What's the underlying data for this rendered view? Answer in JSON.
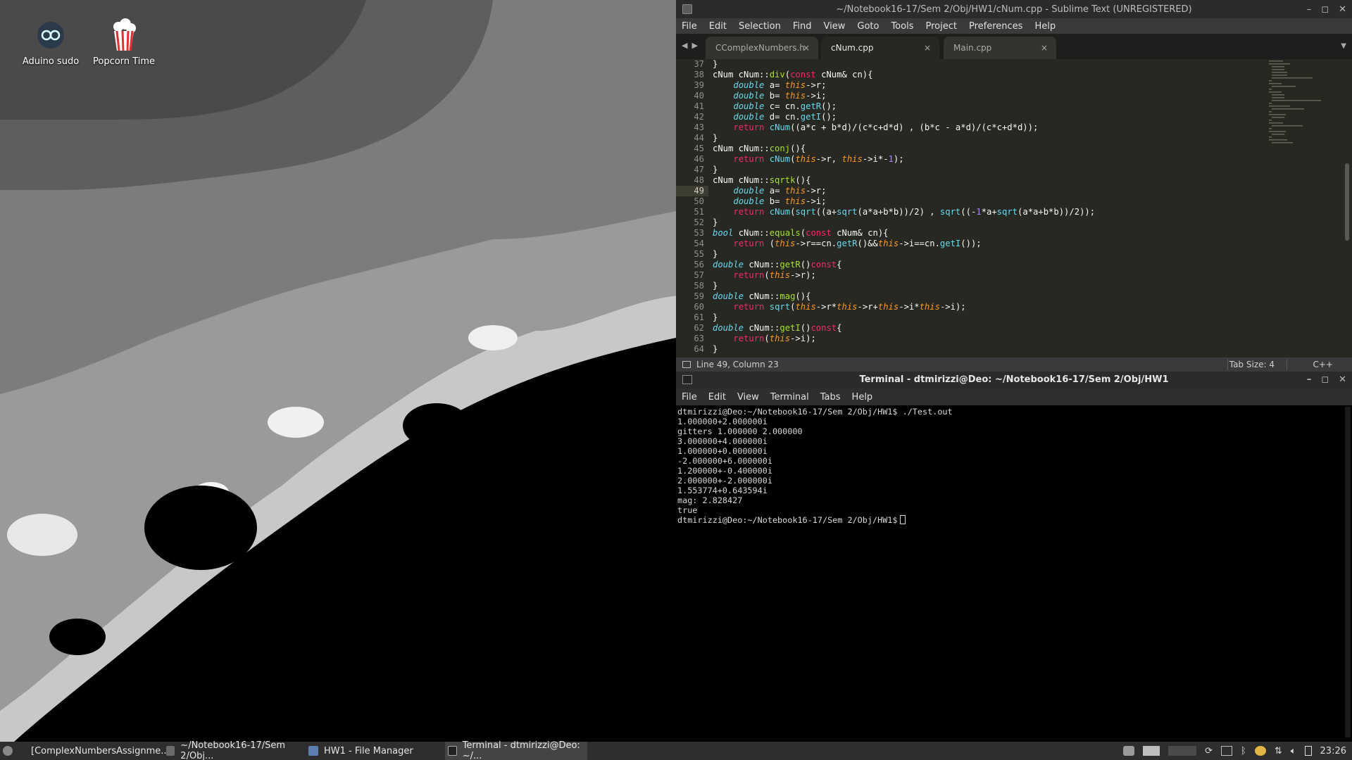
{
  "desktop": {
    "icons": [
      {
        "label": "Aduino sudo"
      },
      {
        "label": "Popcorn Time"
      }
    ]
  },
  "sublime": {
    "title": "~/Notebook16-17/Sem 2/Obj/HW1/cNum.cpp - Sublime Text (UNREGISTERED)",
    "menu": [
      "File",
      "Edit",
      "Selection",
      "Find",
      "View",
      "Goto",
      "Tools",
      "Project",
      "Preferences",
      "Help"
    ],
    "tabs": [
      {
        "label": "CComplexNumbers.h",
        "close": "×"
      },
      {
        "label": "cNum.cpp",
        "close": "×"
      },
      {
        "label": "Main.cpp",
        "close": "×"
      }
    ],
    "line_numbers": [
      "37",
      "38",
      "39",
      "40",
      "41",
      "42",
      "43",
      "44",
      "45",
      "46",
      "47",
      "48",
      "49",
      "50",
      "51",
      "52",
      "53",
      "54",
      "55",
      "56",
      "57",
      "58",
      "59",
      "60",
      "61",
      "62",
      "63",
      "64"
    ],
    "current_line": "49",
    "code_lines": [
      "}",
      "cNum cNum::div(const cNum& cn){",
      "    double a= this->r;",
      "    double b= this->i;",
      "    double c= cn.getR();",
      "    double d= cn.getI();",
      "    return cNum((a*c + b*d)/(c*c+d*d) , (b*c - a*d)/(c*c+d*d));",
      "}",
      "cNum cNum::conj(){",
      "    return cNum(this->r, this->i*-1);",
      "}",
      "cNum cNum::sqrtk(){",
      "    double a= this->r;",
      "    double b= this->i;",
      "    return cNum(sqrt((a+sqrt(a*a+b*b))/2) , sqrt((-1*a+sqrt(a*a+b*b))/2));",
      "}",
      "bool cNum::equals(const cNum& cn){",
      "    return (this->r==cn.getR()&&this->i==cn.getI());",
      "}",
      "double cNum::getR()const{",
      "    return(this->r);",
      "}",
      "double cNum::mag(){",
      "    return sqrt(this->r*this->r+this->i*this->i);",
      "}",
      "double cNum::getI()const{",
      "    return(this->i);",
      "}"
    ],
    "status": {
      "position": "Line 49, Column 23",
      "tab_size": "Tab Size: 4",
      "syntax": "C++"
    }
  },
  "terminal": {
    "title": "Terminal - dtmirizzi@Deo: ~/Notebook16-17/Sem 2/Obj/HW1",
    "menu": [
      "File",
      "Edit",
      "View",
      "Terminal",
      "Tabs",
      "Help"
    ],
    "lines": [
      "dtmirizzi@Deo:~/Notebook16-17/Sem 2/Obj/HW1$ ./Test.out",
      "1.000000+2.000000i",
      "gitters 1.000000 2.000000",
      "3.000000+4.000000i",
      "1.000000+0.000000i",
      "-2.000000+6.000000i",
      "1.200000+-0.400000i",
      "2.000000+-2.000000i",
      "1.553774+0.643594i",
      "mag: 2.828427",
      "true"
    ],
    "prompt": "dtmirizzi@Deo:~/Notebook16-17/Sem 2/Obj/HW1$"
  },
  "taskbar": {
    "tasks": [
      {
        "label": "[ComplexNumbersAssignme..."
      },
      {
        "label": "~/Notebook16-17/Sem 2/Obj..."
      },
      {
        "label": "HW1 - File Manager"
      },
      {
        "label": "Terminal - dtmirizzi@Deo: ~/..."
      }
    ],
    "clock": "23:26"
  },
  "colors": {
    "sublime_bg": "#272822",
    "keyword": "#f92672",
    "type": "#66d9ef",
    "function": "#a6e22e",
    "this": "#fd971f",
    "number": "#ae81ff"
  }
}
